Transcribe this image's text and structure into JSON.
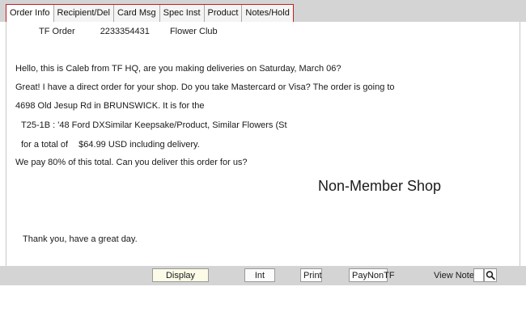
{
  "tabs": [
    {
      "label": "Order Info",
      "active": true
    },
    {
      "label": "Recipient/Del"
    },
    {
      "label": "Card Msg"
    },
    {
      "label": "Spec Inst"
    },
    {
      "label": "Product"
    },
    {
      "label": "Notes/Hold"
    }
  ],
  "order": {
    "source": "TF Order",
    "number": "2233354431",
    "shop": "Flower Club"
  },
  "script": {
    "line1": "Hello, this is Caleb from TF HQ, are you making deliveries on Saturday, March 06?",
    "line2": "Great! I have a direct order for your shop. Do you take Mastercard or Visa? The order is going to",
    "line3": "4698 Old Jesup Rd in BRUNSWICK.  It is for the",
    "line4": "T25-1B  : '48 Ford DXSimilar Keepsake/Product, Similar Flowers (St",
    "line5_prefix": "for a total of",
    "line5_amount": "$64.99 USD including delivery.",
    "line6": "We pay 80% of this total. Can you deliver this order for us?",
    "closing": "Thank you, have a great day."
  },
  "shop_status": "Non-Member Shop",
  "buttons": {
    "display_order": "Display Order",
    "int_min": "Int Min",
    "print": "Print",
    "pay_non_tf": "PayNonTF"
  },
  "view_notes_label": "View Notes",
  "icons": {
    "search": "search-icon"
  }
}
